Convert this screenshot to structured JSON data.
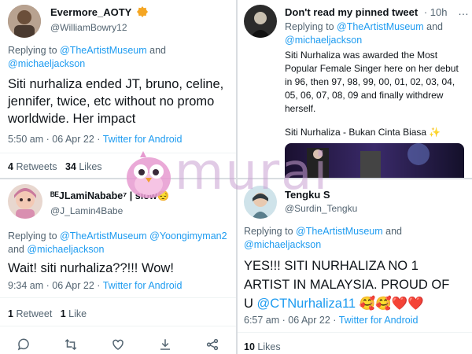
{
  "tweet1": {
    "display_name": "Evermore_AOTY",
    "handle": "@WilliamBowry12",
    "replying_prefix": "Replying to",
    "replying_to_1": "@TheArtistMuseum",
    "replying_and": "and",
    "replying_to_2": "@michaeljackson",
    "text": "Siti nurhaliza ended JT, bruno, celine, jennifer, twice, etc without no promo worldwide. Her impact",
    "time": "5:50 am · 06 Apr 22 ·",
    "source": "Twitter for Android",
    "retweets_count": "4",
    "retweets_label": "Retweets",
    "likes_count": "34",
    "likes_label": "Likes",
    "badge_color": "#f5a623"
  },
  "tweet2": {
    "display_name": "ᴮᴱJLamiNababe⁷ | slow😔",
    "handle": "@J_Lamin4Babe",
    "replying_prefix": "Replying to",
    "replying_to_1": "@TheArtistMuseum",
    "replying_to_2": "@Yoongimyman2",
    "replying_and": "and",
    "replying_to_3": "@michaeljackson",
    "text": "Wait! siti nurhaliza??!!! Wow!",
    "time": "9:34 am · 06 Apr 22 ·",
    "source": "Twitter for Android",
    "retweets_count": "1",
    "retweets_label": "Retweet",
    "likes_count": "1",
    "likes_label": "Like"
  },
  "tweet3": {
    "display_name": "Don't read my pinned tweet",
    "time_ago": "· 10h",
    "replying_prefix": "Replying to",
    "replying_to_1": "@TheArtistMuseum",
    "replying_and": "and",
    "replying_to_2": "@michaeljackson",
    "text": "Siti Nurhaliza was awarded the Most Popular Female Singer here on her debut in 96, then 97, 98, 99, 00, 01, 02, 03, 04, 05, 06, 07, 08, 09 and finally withdrew herself.",
    "video_caption": "Siti Nurhaliza - Bukan Cinta Biasa ✨"
  },
  "tweet4": {
    "display_name": "Tengku S",
    "handle": "@Surdin_Tengku",
    "replying_prefix": "Replying to",
    "replying_to_1": "@TheArtistMuseum",
    "replying_and": "and",
    "replying_to_2": "@michaeljackson",
    "text_line1": "YES!!! SITI NURHALIZA NO 1",
    "text_line2": "ARTIST IN MALAYSIA. PROUD OF",
    "text_line3_prefix": "U",
    "text_mention": "@CTNurhaliza11",
    "text_emoji": "🥰🥰❤️❤️",
    "time": "6:57 am · 06 Apr 22 ·",
    "source": "Twitter for Android",
    "likes_count": "10",
    "likes_label": "Likes"
  },
  "actions": {
    "reply_icon": "reply-icon",
    "retweet_icon": "retweet-icon",
    "like_icon": "heart-icon",
    "download_icon": "download-icon",
    "share_icon": "share-icon"
  },
  "watermark": {
    "text": "murai"
  },
  "colors": {
    "link": "#1d9bf0",
    "secondary_text": "#536471",
    "primary_text": "#0f1419"
  }
}
